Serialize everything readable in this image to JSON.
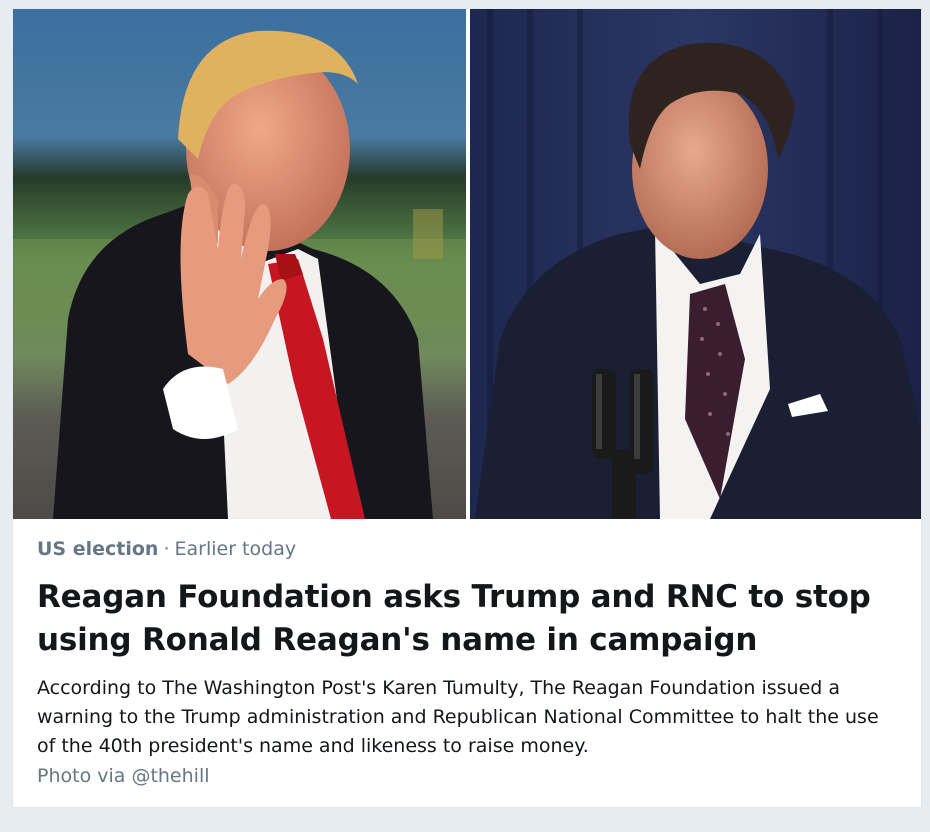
{
  "media": {
    "left_photo_alt": "Donald Trump waving",
    "right_photo_alt": "Ronald Reagan speaking at podium"
  },
  "meta": {
    "category": "US election",
    "separator": "·",
    "time": "Earlier today"
  },
  "headline": "Reagan Foundation asks Trump and RNC to stop using Ronald Reagan's name in campaign",
  "summary": "According to The Washington Post's Karen Tumulty, The Reagan Foundation issued a warning to the Trump administration and Republican National Committee to halt the use of the 40th president's name and likeness to raise money.",
  "credit": "Photo via @thehill",
  "colors": {
    "background": "#e6ecf0",
    "card": "#ffffff",
    "secondary_text": "#657786",
    "primary_text": "#14171a"
  }
}
